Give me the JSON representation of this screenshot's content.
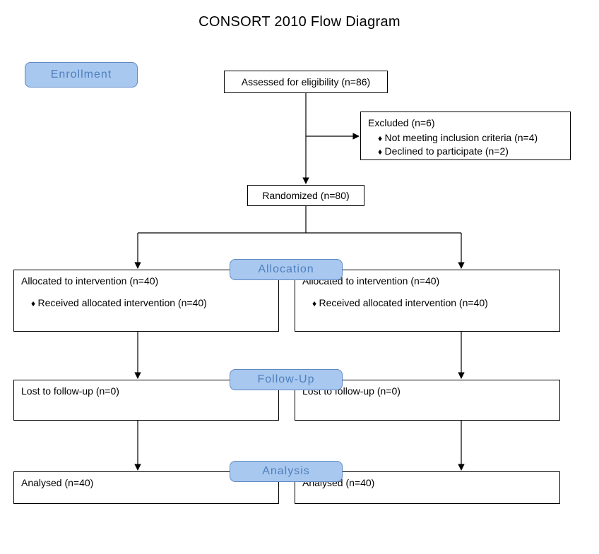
{
  "title": "CONSORT 2010 Flow Diagram",
  "phases": {
    "enrollment": "Enrollment",
    "allocation": "Allocation",
    "followup": "Follow-Up",
    "analysis": "Analysis"
  },
  "enrollment": {
    "assessed": "Assessed for eligibility (n=86)",
    "excluded_title": "Excluded (n=6)",
    "excluded_reason_criteria": "Not meeting inclusion criteria (n=4)",
    "excluded_reason_declined": "Declined to participate (n=2)",
    "randomized": "Randomized (n=80)"
  },
  "allocation": {
    "left": {
      "title": "Allocated to intervention (n=40)",
      "received": "Received allocated intervention (n=40)"
    },
    "right": {
      "title": "Allocated to intervention (n=40)",
      "received": "Received allocated intervention (n=40)"
    }
  },
  "followup": {
    "left": "Lost to follow-up (n=0)",
    "right": "Lost to follow-up (n=0)"
  },
  "analysis": {
    "left": "Analysed (n=40)",
    "right": "Analysed (n=40)"
  }
}
